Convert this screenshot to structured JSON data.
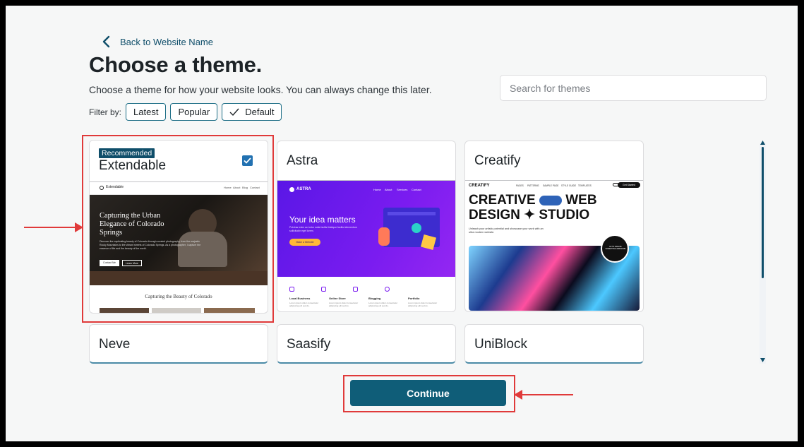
{
  "back_label": "Back to Website Name",
  "title": "Choose a theme.",
  "subtitle": "Choose a theme for how your website looks. You can always change this later.",
  "filter": {
    "label": "Filter by:",
    "options": [
      "Latest",
      "Popular",
      "Default"
    ],
    "selected": "Default"
  },
  "search": {
    "placeholder": "Search for themes",
    "value": ""
  },
  "themes": [
    {
      "name": "Extendable",
      "badge": "Recommended",
      "selected": true,
      "preview": {
        "brand": "Extendable",
        "nav": [
          "Home",
          "About",
          "Blog",
          "Contact"
        ],
        "hero": "Capturing the Urban Elegance of Colorado Springs",
        "body": "Discover the captivating beauty of Colorado through curated photography, from the majestic Rocky Mountains to the vibrant streets of Colorado Springs. As a photographer, I capture the essence of life and the beauty of the world.",
        "buttons": [
          "Contact Me",
          "Learn More"
        ],
        "section": "Capturing the Beauty of Colorado"
      }
    },
    {
      "name": "Astra",
      "preview": {
        "brand": "ASTRA",
        "nav": [
          "Home",
          "About",
          "Services",
          "Contact"
        ],
        "hero": "Your idea matters",
        "body": "Pulvinar enim ac tortor nulla facilisi tristique facilisi elementum sollicitudin eget lorem.",
        "button": "Make a Website",
        "features": [
          "Local Business",
          "Online Store",
          "Blogging",
          "Portfolio"
        ],
        "feature_text": "Lorem ipsum dolor consectetur adipiscing elit sed do."
      }
    },
    {
      "name": "Creatify",
      "preview": {
        "brand": "CREATIFY",
        "nav": [
          "PAGES",
          "PATTERNS",
          "SAMPLE PAGE",
          "STYLE GUIDE",
          "TEMPLATES"
        ],
        "cta": "Get Started",
        "headline_1": "CREATIVE",
        "headline_2": "WEB",
        "headline_3": "DESIGN",
        "headline_4": "STUDIO",
        "body": "Unleash your artistic potential and showcase your work with an ultra modern website.",
        "stamp": "LET'S CREATE SOMETHING AWESOME"
      }
    },
    {
      "name": "Neve"
    },
    {
      "name": "Saasify"
    },
    {
      "name": "UniBlock"
    }
  ],
  "continue_label": "Continue",
  "colors": {
    "primary": "#0f5d78",
    "highlight": "#e03a3a",
    "astra_purple": "#6a1bf0",
    "checkbox": "#2271b1"
  }
}
